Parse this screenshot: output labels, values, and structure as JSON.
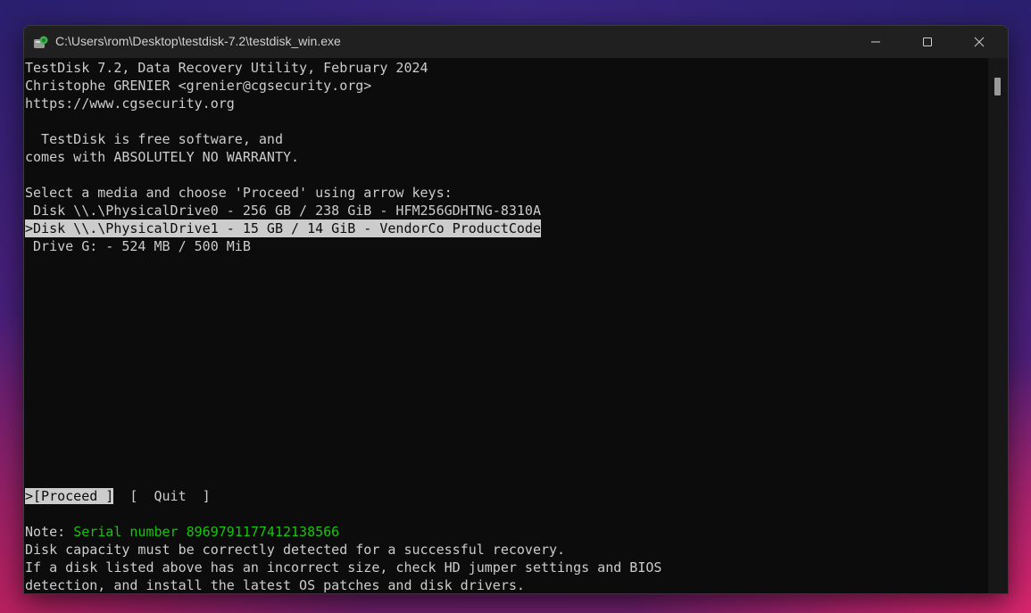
{
  "window": {
    "title": "C:\\Users\\rom\\Desktop\\testdisk-7.2\\testdisk_win.exe"
  },
  "console": {
    "header": [
      "TestDisk 7.2, Data Recovery Utility, February 2024",
      "Christophe GRENIER <grenier@cgsecurity.org>",
      "https://www.cgsecurity.org"
    ],
    "license": [
      "  TestDisk is free software, and",
      "comes with ABSOLUTELY NO WARRANTY."
    ],
    "prompt": "Select a media and choose 'Proceed' using arrow keys:",
    "media": [
      " Disk \\\\.\\PhysicalDrive0 - 256 GB / 238 GiB - HFM256GDHTNG-8310A",
      ">Disk \\\\.\\PhysicalDrive1 - 15 GB / 14 GiB - VendorCo ProductCode",
      " Drive G: - 524 MB / 500 MiB"
    ],
    "selected_media_index": 1,
    "actions": {
      "proceed": ">[Proceed ]",
      "separator": "  [  ",
      "quit": "Quit",
      "quit_close": "  ]"
    },
    "note": {
      "prefix": "Note: ",
      "serial": "Serial number 8969791177412138566",
      "lines": [
        "Disk capacity must be correctly detected for a successful recovery.",
        "If a disk listed above has an incorrect size, check HD jumper settings and BIOS",
        "detection, and install the latest OS patches and disk drivers."
      ]
    }
  },
  "icons": {
    "app": "testdisk-app-icon",
    "minimize": "minimize-icon",
    "maximize": "maximize-icon",
    "close": "close-icon"
  },
  "colors": {
    "terminal_bg": "#0c0c0c",
    "terminal_fg": "#cccccc",
    "highlight_bg": "#cccccc",
    "serial_green": "#16c60c",
    "titlebar_bg": "#202020"
  }
}
